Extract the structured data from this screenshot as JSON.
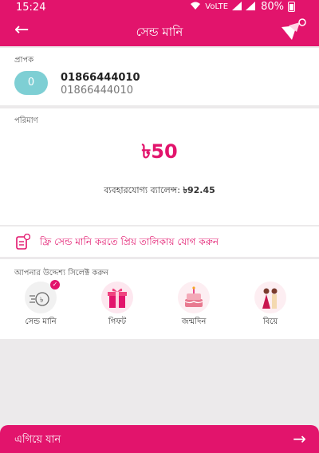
{
  "status": {
    "time": "15:24",
    "battery": "80%",
    "network": "VoLTE"
  },
  "header": {
    "title": "সেন্ড মানি",
    "back_icon": "arrow-left-icon",
    "logo_icon": "bkash-bird-logo"
  },
  "recipient": {
    "section_label": "প্রাপক",
    "avatar_initial": "0",
    "name": "01866444010",
    "number": "01866444010"
  },
  "amount": {
    "section_label": "পরিমাণ",
    "value": "৳50",
    "balance_text": "ব্যবহারযোগ্য ব্যালেন্স: ",
    "balance_value": "৳92.45"
  },
  "favorite": {
    "text": "ফ্রি সেন্ড মানি করতে প্রিয় তালিকায় যোগ করুন"
  },
  "purpose": {
    "section_label": "আপনার উদ্দেশ্য সিলেক্ট করুন",
    "items": [
      {
        "label": "সেন্ড মানি",
        "icon": "send-money-icon",
        "selected": true
      },
      {
        "label": "গিফট",
        "icon": "gift-icon",
        "selected": false
      },
      {
        "label": "জন্মদিন",
        "icon": "birthday-cake-icon",
        "selected": false
      },
      {
        "label": "বিয়ে",
        "icon": "wedding-icon",
        "selected": false
      }
    ]
  },
  "footer": {
    "next_label": "এগিয়ে যান"
  },
  "colors": {
    "brand": "#e2146c",
    "avatar": "#7ecfd4"
  }
}
